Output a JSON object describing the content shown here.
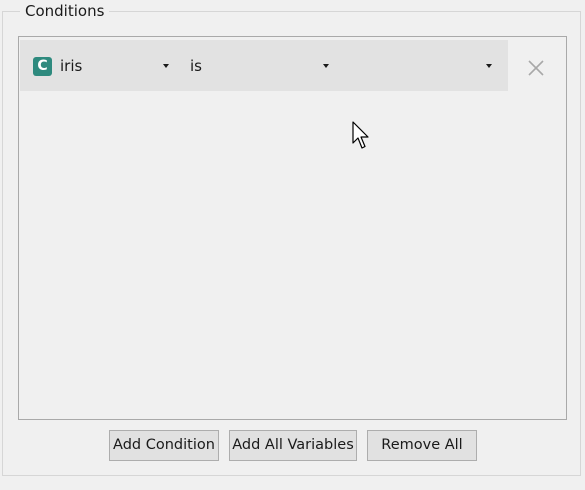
{
  "group": {
    "title": "Conditions"
  },
  "condition": {
    "badge": "C",
    "variable": "iris",
    "operator": "is",
    "value": ""
  },
  "icons": {
    "remove": "close-icon",
    "dropdown": "dropdown-arrow-icon",
    "pointer": "mouse-pointer-icon"
  },
  "buttons": {
    "add_condition": "Add Condition",
    "add_all_variables": "Add All Variables",
    "remove_all": "Remove All"
  },
  "colors": {
    "badge": "#2e8a7e",
    "row_background": "#e2e2e2",
    "window_background": "#f0f0f0"
  }
}
